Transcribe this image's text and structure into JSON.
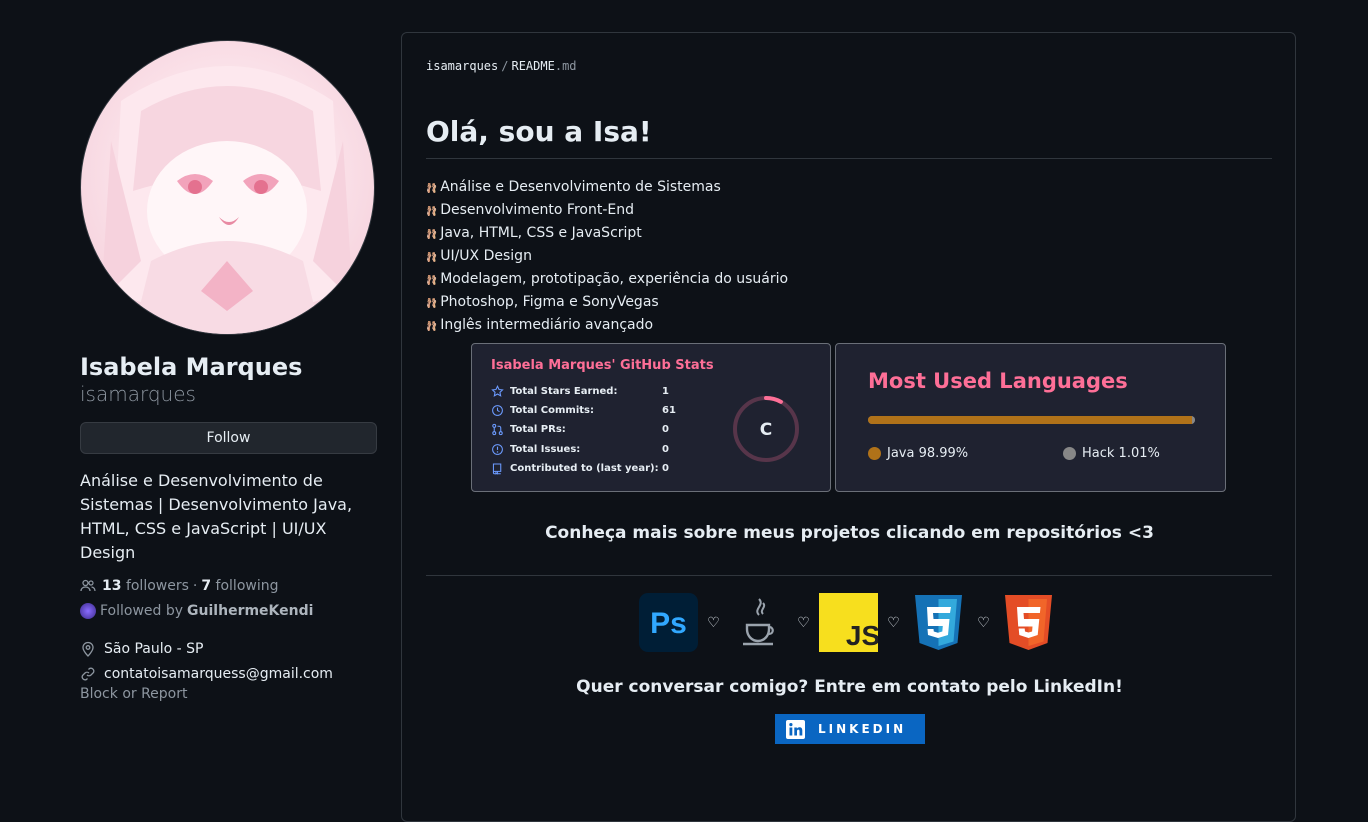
{
  "profile": {
    "full_name": "Isabela Marques",
    "login": "isamarques",
    "follow_label": "Follow",
    "bio": "Análise e Desenvolvimento de Sistemas | Desenvolvimento Java, HTML, CSS e JavaScript | UI/UX Design",
    "followers_count": "13",
    "followers_label": "followers",
    "separator": "·",
    "following_count": "7",
    "following_label": "following",
    "followed_by_prefix": "Followed by",
    "followed_by_user": "GuilhermeKendi",
    "location": "São Paulo - SP",
    "email": "contatoisamarquess@gmail.com",
    "block_label": "Block or Report"
  },
  "readme": {
    "breadcrumb_user": "isamarques",
    "breadcrumb_sep": "/",
    "breadcrumb_file": "README",
    "breadcrumb_ext": ".md",
    "greeting": "Olá, sou a Isa!",
    "skills": [
      "Análise e Desenvolvimento de Sistemas",
      "Desenvolvimento Front-End",
      "Java, HTML, CSS e JavaScript",
      "UI/UX Design",
      "Modelagem, prototipação, experiência do usuário",
      "Photoshop, Figma e SonyVegas",
      "Inglês intermediário avançado"
    ],
    "skill_bullet": "🩰",
    "stats_card": {
      "title": "Isabela Marques' GitHub Stats",
      "rows": [
        {
          "label": "Total Stars Earned:",
          "value": "1",
          "icon": "star-icon"
        },
        {
          "label": "Total Commits:",
          "value": "61",
          "icon": "history-icon"
        },
        {
          "label": "Total PRs:",
          "value": "0",
          "icon": "pull-request-icon"
        },
        {
          "label": "Total Issues:",
          "value": "0",
          "icon": "issue-icon"
        },
        {
          "label": "Contributed to (last year):",
          "value": "0",
          "icon": "repo-icon"
        }
      ],
      "grade": "C",
      "grade_progress": 0.08,
      "accent_color": "#fe6f97",
      "icon_color": "#6c9bff"
    },
    "languages_card": {
      "title": "Most Used Languages",
      "languages": [
        {
          "name": "Java",
          "percent": 98.99,
          "display": "Java 98.99%",
          "color": "#b07219"
        },
        {
          "name": "Hack",
          "percent": 1.01,
          "display": "Hack 1.01%",
          "color": "#878787"
        }
      ]
    },
    "projects_cta": "Conheça mais sobre meus projetos clicando em repositórios <3",
    "tech_icons": [
      "photoshop-icon",
      "java-icon",
      "javascript-icon",
      "css3-icon",
      "html5-icon"
    ],
    "tech_separator": "♡",
    "contact_cta": "Quer conversar comigo? Entre em contato pelo LinkedIn!",
    "linkedin_badge": "LINKEDIN"
  }
}
